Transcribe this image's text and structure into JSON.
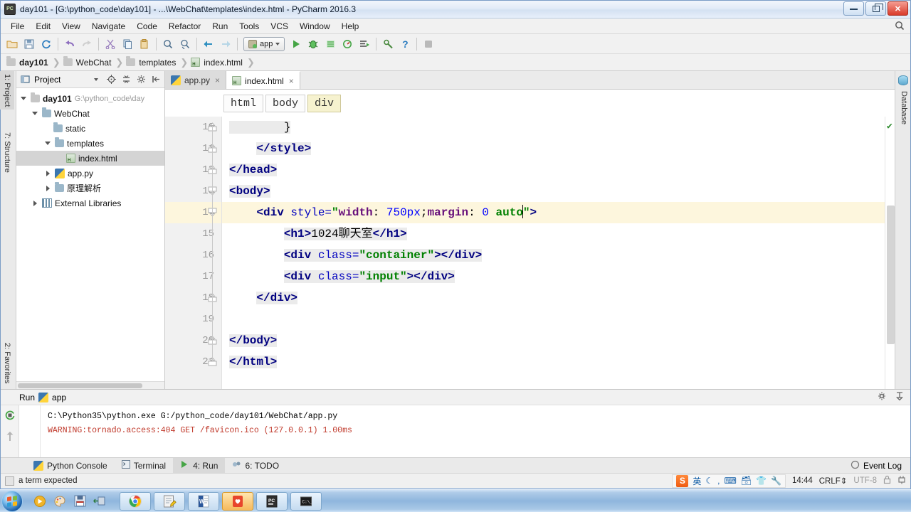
{
  "window": {
    "title": "day101 - [G:\\python_code\\day101] - ...\\WebChat\\templates\\index.html - PyCharm 2016.3",
    "app_icon": "pycharm-icon",
    "minimize_label": "Minimize",
    "maximize_label": "Maximize",
    "close_label": "Close"
  },
  "menubar": {
    "items": [
      {
        "label": "File"
      },
      {
        "label": "Edit"
      },
      {
        "label": "View"
      },
      {
        "label": "Navigate"
      },
      {
        "label": "Code"
      },
      {
        "label": "Refactor"
      },
      {
        "label": "Run"
      },
      {
        "label": "Tools"
      },
      {
        "label": "VCS"
      },
      {
        "label": "Window"
      },
      {
        "label": "Help"
      }
    ],
    "search_icon": "search-icon"
  },
  "toolbar": {
    "buttons": [
      {
        "name": "open-folder-icon"
      },
      {
        "name": "save-all-icon"
      },
      {
        "name": "sync-refresh-icon"
      },
      {
        "name": "undo-icon"
      },
      {
        "name": "redo-icon"
      },
      {
        "name": "cut-icon"
      },
      {
        "name": "copy-icon"
      },
      {
        "name": "paste-icon"
      },
      {
        "name": "find-icon"
      },
      {
        "name": "replace-icon"
      },
      {
        "name": "back-icon"
      },
      {
        "name": "forward-icon"
      }
    ],
    "run_config": "app",
    "run_config_dropdown": "▾",
    "actions": [
      {
        "name": "run-icon"
      },
      {
        "name": "debug-icon"
      },
      {
        "name": "coverage-icon"
      },
      {
        "name": "profile-icon"
      },
      {
        "name": "run-with-console-icon"
      },
      {
        "name": "settings-icon"
      },
      {
        "name": "help-icon"
      },
      {
        "name": "stop-icon"
      }
    ]
  },
  "breadcrumb": {
    "items": [
      {
        "label": "day101",
        "icon": "folder-icon"
      },
      {
        "label": "WebChat",
        "icon": "folder-icon"
      },
      {
        "label": "templates",
        "icon": "folder-icon"
      },
      {
        "label": "index.html",
        "icon": "html-file-icon"
      }
    ]
  },
  "left_strip": {
    "tabs": [
      {
        "label": "1: Project",
        "icon": "project-icon"
      },
      {
        "label": "7: Structure",
        "icon": "structure-icon"
      },
      {
        "label": "2: Favorites",
        "icon": "star-icon"
      }
    ]
  },
  "right_strip": {
    "tabs": [
      {
        "label": "Database",
        "icon": "database-icon"
      }
    ]
  },
  "project_panel": {
    "title": "Project",
    "header_icons": [
      {
        "name": "chevron-down-icon"
      },
      {
        "name": "target-locate-icon"
      },
      {
        "name": "collapse-all-icon"
      },
      {
        "name": "gear-icon"
      },
      {
        "name": "hide-panel-icon"
      }
    ],
    "tree": [
      {
        "label": "day101",
        "path": "G:\\python_code\\day",
        "icon": "folder-icon",
        "depth": 0,
        "twisty": "down",
        "bold": true,
        "selected": false
      },
      {
        "label": "WebChat",
        "path": "",
        "icon": "folder-icon",
        "depth": 1,
        "twisty": "down",
        "bold": false,
        "selected": false
      },
      {
        "label": "static",
        "path": "",
        "icon": "folder-icon",
        "depth": 2,
        "twisty": "none",
        "bold": false,
        "selected": false
      },
      {
        "label": "templates",
        "path": "",
        "icon": "folder-icon",
        "depth": 2,
        "twisty": "down",
        "bold": false,
        "selected": false
      },
      {
        "label": "index.html",
        "path": "",
        "icon": "html-file-icon",
        "depth": 3,
        "twisty": "none",
        "bold": false,
        "selected": true
      },
      {
        "label": "app.py",
        "path": "",
        "icon": "python-file-icon",
        "depth": 2,
        "twisty": "right",
        "bold": false,
        "selected": false
      },
      {
        "label": "原理解析",
        "path": "",
        "icon": "folder-icon",
        "depth": 2,
        "twisty": "right",
        "bold": false,
        "selected": false
      },
      {
        "label": "External Libraries",
        "path": "",
        "icon": "libraries-icon",
        "depth": 1,
        "twisty": "right",
        "bold": false,
        "selected": false
      }
    ]
  },
  "editor": {
    "tabs": [
      {
        "label": "app.py",
        "icon": "python-file-icon",
        "active": false,
        "close": "×"
      },
      {
        "label": "index.html",
        "icon": "html-file-icon",
        "active": true,
        "close": "×"
      }
    ],
    "tag_breadcrumb": [
      {
        "label": "html",
        "selected": false
      },
      {
        "label": "body",
        "selected": false
      },
      {
        "label": "div",
        "selected": true
      }
    ],
    "first_line_number": 10,
    "lines": [
      {
        "num": 10,
        "highlight": false,
        "fold": "end",
        "tokens": [
          {
            "t": "        }",
            "c": "plain",
            "hl": true
          }
        ]
      },
      {
        "num": 11,
        "highlight": false,
        "fold": "end",
        "tokens": [
          {
            "t": "    ",
            "c": "plain",
            "hl": false
          },
          {
            "t": "</style>",
            "c": "tag",
            "hl": true
          }
        ]
      },
      {
        "num": 12,
        "highlight": false,
        "fold": "end",
        "tokens": [
          {
            "t": "</head>",
            "c": "tag",
            "hl": true
          }
        ]
      },
      {
        "num": 13,
        "highlight": false,
        "fold": "start",
        "tokens": [
          {
            "t": "<body>",
            "c": "tag",
            "hl": true
          }
        ]
      },
      {
        "num": 14,
        "highlight": true,
        "fold": "start",
        "tokens": [
          {
            "t": "    ",
            "c": "plain",
            "hl": false
          },
          {
            "t": "<div ",
            "c": "tag",
            "hl": false
          },
          {
            "t": "style=",
            "c": "attr",
            "hl": false
          },
          {
            "t": "\"",
            "c": "str",
            "hl": false
          },
          {
            "t": "width",
            "c": "prop",
            "hl": false
          },
          {
            "t": ": ",
            "c": "plain",
            "hl": false
          },
          {
            "t": "750",
            "c": "num",
            "hl": false
          },
          {
            "t": "px",
            "c": "unit",
            "hl": false
          },
          {
            "t": ";",
            "c": "plain",
            "hl": false
          },
          {
            "t": "margin",
            "c": "prop",
            "hl": false
          },
          {
            "t": ": ",
            "c": "plain",
            "hl": false
          },
          {
            "t": "0",
            "c": "num",
            "hl": false
          },
          {
            "t": " ",
            "c": "plain",
            "hl": false
          },
          {
            "t": "auto",
            "c": "str",
            "hl": false
          },
          {
            "t": "CARET",
            "c": "caret",
            "hl": false
          },
          {
            "t": "\"",
            "c": "str",
            "hl": false
          },
          {
            "t": ">",
            "c": "tag",
            "hl": false
          }
        ]
      },
      {
        "num": 15,
        "highlight": false,
        "fold": "none",
        "tokens": [
          {
            "t": "        ",
            "c": "plain",
            "hl": false
          },
          {
            "t": "<h1>",
            "c": "tag",
            "hl": true
          },
          {
            "t": "1024聊天室",
            "c": "plain",
            "hl": true
          },
          {
            "t": "</h1>",
            "c": "tag",
            "hl": true
          }
        ]
      },
      {
        "num": 16,
        "highlight": false,
        "fold": "none",
        "tokens": [
          {
            "t": "        ",
            "c": "plain",
            "hl": false
          },
          {
            "t": "<div ",
            "c": "tag",
            "hl": true
          },
          {
            "t": "class=",
            "c": "attr",
            "hl": true
          },
          {
            "t": "\"container\"",
            "c": "str",
            "hl": true
          },
          {
            "t": ">",
            "c": "tag",
            "hl": true
          },
          {
            "t": "</div>",
            "c": "tag",
            "hl": true
          }
        ]
      },
      {
        "num": 17,
        "highlight": false,
        "fold": "none",
        "tokens": [
          {
            "t": "        ",
            "c": "plain",
            "hl": false
          },
          {
            "t": "<div ",
            "c": "tag",
            "hl": true
          },
          {
            "t": "class=",
            "c": "attr",
            "hl": true
          },
          {
            "t": "\"input\"",
            "c": "str",
            "hl": true
          },
          {
            "t": ">",
            "c": "tag",
            "hl": true
          },
          {
            "t": "</div>",
            "c": "tag",
            "hl": true
          }
        ]
      },
      {
        "num": 18,
        "highlight": false,
        "fold": "end",
        "tokens": [
          {
            "t": "    ",
            "c": "plain",
            "hl": false
          },
          {
            "t": "</div>",
            "c": "tag",
            "hl": true
          }
        ]
      },
      {
        "num": 19,
        "highlight": false,
        "fold": "none",
        "tokens": [
          {
            "t": "",
            "c": "plain",
            "hl": false
          }
        ]
      },
      {
        "num": 20,
        "highlight": false,
        "fold": "end",
        "tokens": [
          {
            "t": "</body>",
            "c": "tag",
            "hl": true
          }
        ]
      },
      {
        "num": 21,
        "highlight": false,
        "fold": "end",
        "tokens": [
          {
            "t": "</html>",
            "c": "tag",
            "hl": true
          }
        ]
      }
    ],
    "inspection_status": "✔"
  },
  "run_panel": {
    "title": "Run",
    "config_name": "app",
    "config_icon": "python-icon",
    "gutter_icons": [
      {
        "name": "rerun-icon"
      },
      {
        "name": "scroll-up-icon"
      }
    ],
    "header_icons": [
      {
        "name": "settings-gear-icon"
      },
      {
        "name": "pin-icon"
      }
    ],
    "console_lines": [
      {
        "text": "C:\\Python35\\python.exe G:/python_code/day101/WebChat/app.py",
        "style": "cmd"
      },
      {
        "text": "WARNING:tornado.access:404 GET /favicon.ico (127.0.0.1) 1.00ms",
        "style": "warn"
      }
    ]
  },
  "bottom_tabs": {
    "items": [
      {
        "label": "Python Console",
        "icon": "python-console-icon",
        "selected": false
      },
      {
        "label": "Terminal",
        "icon": "terminal-icon",
        "selected": false
      },
      {
        "label": "4: Run",
        "icon": "run-icon",
        "selected": true
      },
      {
        "label": "6: TODO",
        "icon": "todo-icon",
        "selected": false
      }
    ],
    "event_log": "Event Log",
    "event_log_icon": "event-log-icon"
  },
  "statusbar": {
    "message": "a term expected",
    "message_icon": "inspection-icon",
    "time": "14:44",
    "line_separator": "CRLF",
    "line_separator_caret": "⇕",
    "encoding": "UTF-8",
    "lock_icon": "lock-icon",
    "plug_icon": "plug-icon",
    "ime": {
      "logo": "S",
      "mode": "英",
      "icons": [
        {
          "name": "moon-icon"
        },
        {
          "name": "comma-icon"
        },
        {
          "name": "keyboard-icon"
        },
        {
          "name": "toolbox-icon"
        },
        {
          "name": "skin-icon"
        },
        {
          "name": "wrench-icon"
        }
      ]
    }
  },
  "taskbar": {
    "start_label": "Start",
    "quick_launch": [
      {
        "name": "media-player-icon"
      },
      {
        "name": "paint-icon"
      },
      {
        "name": "save-icon"
      },
      {
        "name": "connect-icon"
      }
    ],
    "tasks": [
      {
        "name": "chrome-taskbar-button",
        "active": false
      },
      {
        "name": "editor-taskbar-button",
        "active": false
      },
      {
        "name": "word-taskbar-button",
        "active": false
      },
      {
        "name": "app-taskbar-button",
        "active": true
      },
      {
        "name": "pycharm-taskbar-button",
        "active": false
      },
      {
        "name": "cmd-taskbar-button",
        "active": false
      }
    ]
  },
  "colors": {
    "accent": "#2e6da4",
    "highlight_line": "#fdf6dd",
    "selection": "#d4d4d4",
    "tag": "#000080",
    "string": "#008000",
    "property": "#660e7a",
    "number": "#0000ff",
    "warning": "#c0392b"
  }
}
